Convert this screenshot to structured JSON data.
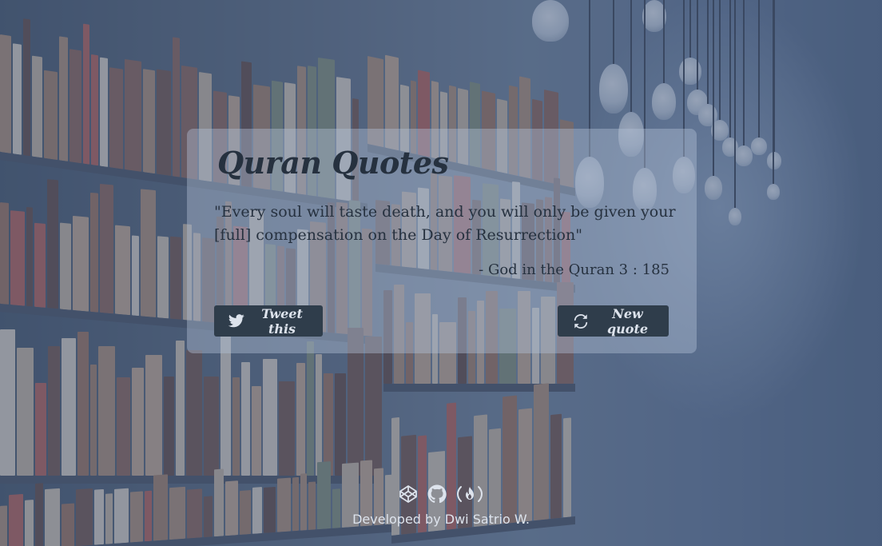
{
  "app": {
    "title": "Quran Quotes"
  },
  "quote": {
    "text": "\"Every soul will taste death, and you will only be given your [full] compensation on the Day of Resurrection\"",
    "source": "- God in the Quran 3 : 185"
  },
  "actions": {
    "tweet_label": "Tweet this",
    "tweet_icon": "twitter-icon",
    "new_quote_label": "New quote",
    "new_quote_icon": "refresh-icon"
  },
  "footer": {
    "links": [
      {
        "icon": "codepen-icon"
      },
      {
        "icon": "github-icon"
      },
      {
        "icon": "freecodecamp-icon"
      }
    ],
    "credit": "Developed by Dwi Satrio W."
  },
  "colors": {
    "card_text": "#26313f",
    "button_bg": "#2f3d4b",
    "button_text": "#dde3ec",
    "footer_text": "#dde3ec"
  }
}
